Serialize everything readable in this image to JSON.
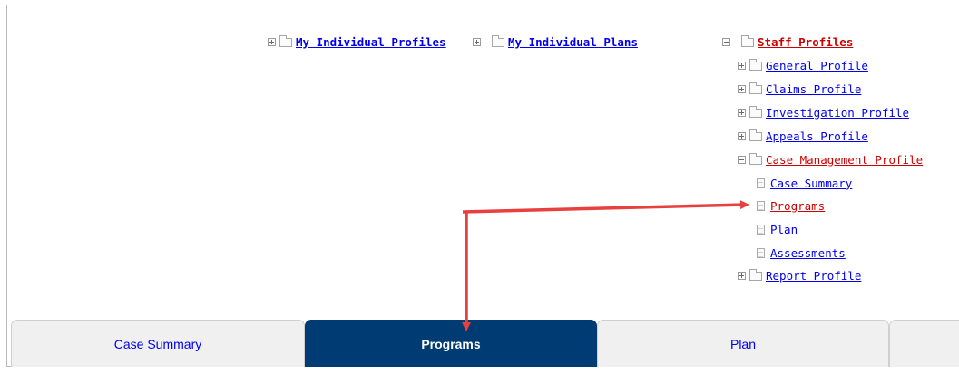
{
  "top_links": {
    "individual_profiles": "My Individual Profiles",
    "individual_plans": "My Individual Plans"
  },
  "tree": {
    "root": "Staff Profiles",
    "general": "General Profile",
    "claims": "Claims Profile",
    "investigation": "Investigation Profile",
    "appeals": "Appeals Profile",
    "case_management": "Case Management Profile",
    "case_summary": "Case Summary",
    "programs": "Programs",
    "plan": "Plan",
    "assessments": "Assessments",
    "report": "Report Profile"
  },
  "tabs": {
    "case_summary": "Case Summary",
    "programs": "Programs",
    "plan": "Plan"
  },
  "colors": {
    "link": "#0000ee",
    "active_link": "#cc0000",
    "active_tab": "#003c73",
    "annotation_arrow": "#e8403f"
  }
}
